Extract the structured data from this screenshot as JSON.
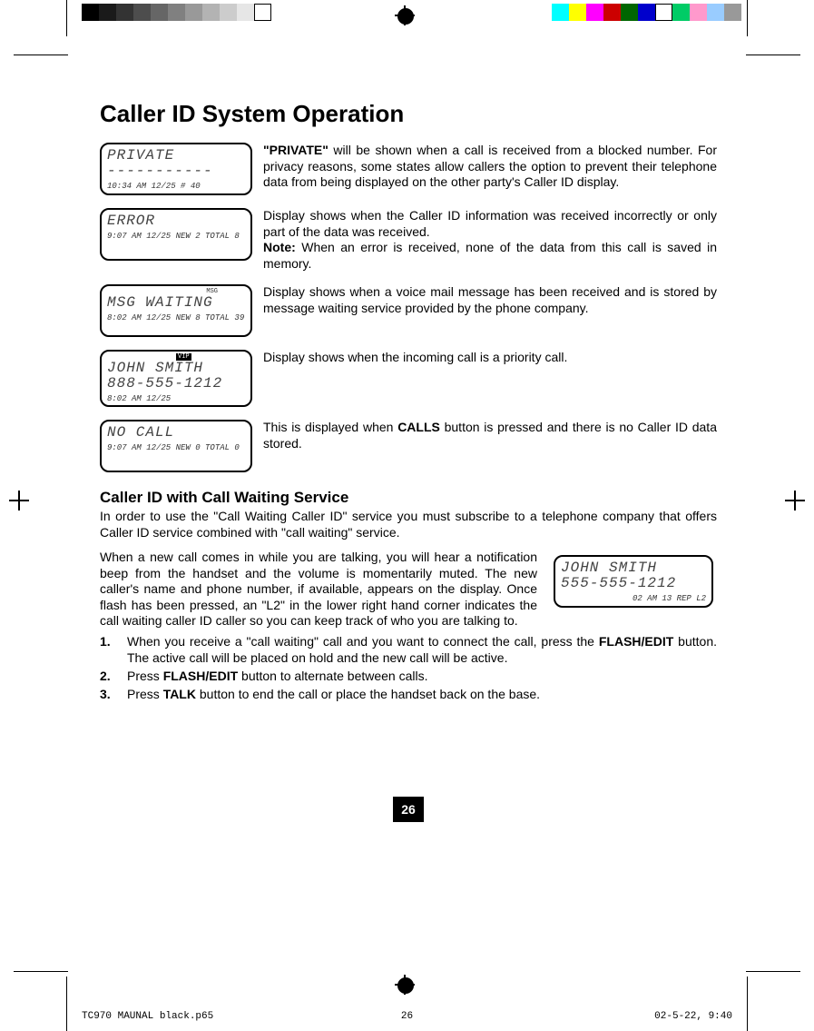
{
  "title": "Caller ID System Operation",
  "displays": [
    {
      "line1": "PRIVATE",
      "line2": "-----------",
      "status": "10:34 AM 12/25   # 40",
      "tag": "",
      "desc_lead_bold": "\"PRIVATE\"",
      "desc_rest": " will be shown when a call is received from a blocked number. For privacy reasons, some states allow callers the option to prevent their telephone data from being displayed on the other party's Caller ID display."
    },
    {
      "line1": "ERROR",
      "line2": "",
      "status": "9:07 AM 12/25 NEW 2 TOTAL 8",
      "tag": "",
      "desc_pre": "Display shows when the Caller ID information was received incorrectly or only part of the data was received.",
      "desc_note_label": "Note:",
      "desc_note_rest": " When an error is received, none of the data from this call is saved in memory."
    },
    {
      "line1": "MSG WAITING",
      "line2": "",
      "status": "8:02 AM 12/25 NEW 8 TOTAL 39",
      "tag": "MSG",
      "desc": "Display shows when a voice mail message has been received and is stored by message waiting service provided by the phone company."
    },
    {
      "line1": "JOHN SMITH",
      "line2": "888-555-1212",
      "status": "8:02 AM 12/25",
      "tag": "VIP",
      "desc": "Display shows when the incoming call is a priority call."
    },
    {
      "line1": "NO CALL",
      "line2": "",
      "status": "9:07 AM 12/25 NEW 0 TOTAL 0",
      "tag": "",
      "desc_pre": "This is displayed when ",
      "desc_bold": "CALLS",
      "desc_post": " button is pressed and there is no Caller ID data stored."
    }
  ],
  "cw_heading": "Caller ID with Call Waiting Service",
  "cw_intro": "In order to use the \"Call Waiting Caller ID\" service you must subscribe to a telephone company that offers Caller ID service combined with \"call waiting\" service.",
  "cw_body": "When a new call comes in while you are talking, you will hear a notification beep from the handset and the volume is momentarily muted. The new caller's name and phone number, if available, appears on the display. Once flash has been pressed, an \"L2\" in the lower right hand corner indicates the call waiting caller ID caller so you can keep track of who you are talking to.",
  "cw_display": {
    "line1": "JOHN SMITH",
    "line2": "555-555-1212",
    "status": "02 AM 13 REP L2"
  },
  "steps": [
    {
      "pre": "When you receive a \"call waiting\" call and you want to connect the call, press the ",
      "b": "FLASH/EDIT",
      "post": " button. The active call will be placed on hold and the new call will be active."
    },
    {
      "pre": "Press ",
      "b": "FLASH/EDIT",
      "post": " button to alternate between calls."
    },
    {
      "pre": "Press ",
      "b": "TALK",
      "post": " button to end the call or place the handset back on the base."
    }
  ],
  "page_number": "26",
  "footer": {
    "left": "TC970 MAUNAL black.p65",
    "middle": "26",
    "right": "02-5-22, 9:40"
  }
}
